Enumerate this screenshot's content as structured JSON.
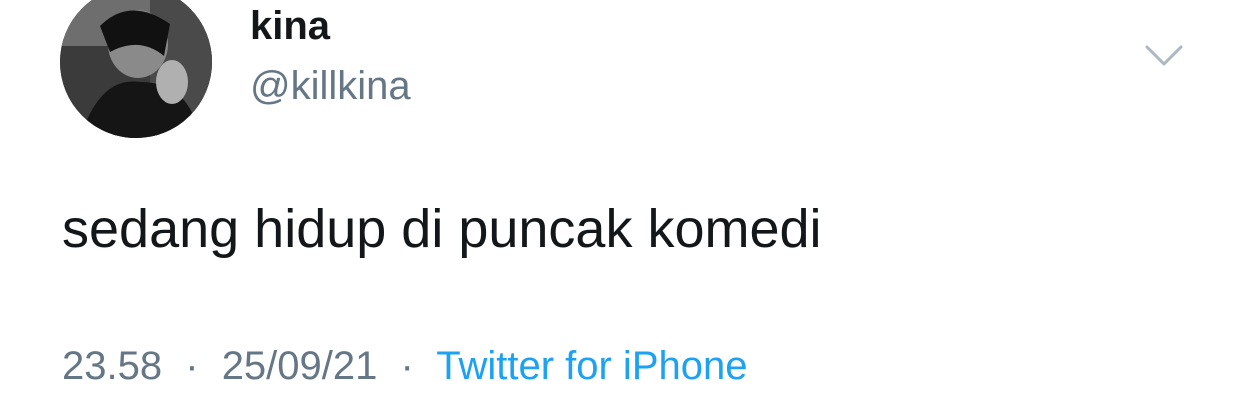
{
  "author": {
    "display_name": "kina",
    "handle": "@killkina"
  },
  "tweet": {
    "text": "sedang hidup di puncak komedi"
  },
  "meta": {
    "time": "23.58",
    "separator": "·",
    "date": "25/09/21",
    "source": "Twitter for iPhone"
  },
  "colors": {
    "text": "#14171a",
    "secondary": "#657786",
    "link": "#1da1f2"
  },
  "icons": {
    "menu": "chevron-down-icon"
  }
}
